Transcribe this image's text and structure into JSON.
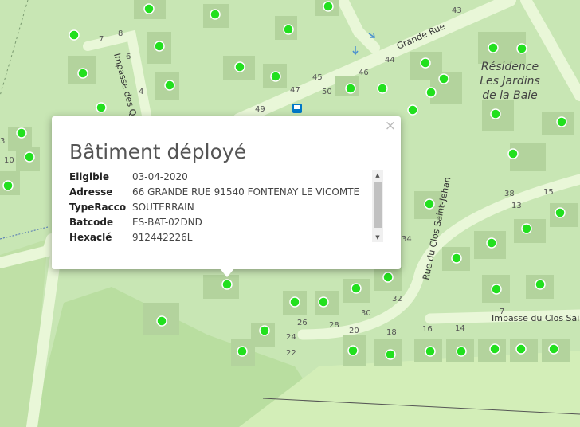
{
  "map": {
    "street_labels": {
      "grande_rue": "Grande Rue",
      "impasse_des": "Impasse des Q",
      "clos_saint_jehan": "Rue du Clos Saint-Jehan",
      "impasse_clos_saint": "Impasse du Clos Sai"
    },
    "residence": {
      "line1": "Résidence",
      "line2": "Les Jardins",
      "line3": "de la Baie"
    },
    "house_numbers": [
      "7",
      "8",
      "6",
      "4",
      "49",
      "47",
      "45",
      "46",
      "50",
      "44",
      "43",
      "3",
      "10",
      "38",
      "15",
      "13",
      "34",
      "32",
      "30",
      "26",
      "28",
      "24",
      "22",
      "20",
      "18",
      "16",
      "14",
      "7"
    ],
    "colors": {
      "background": "#c8e6b4",
      "road": "#e9f7d8",
      "marker": "#22e01e",
      "building": "#b3d39d"
    }
  },
  "popup": {
    "title": "Bâtiment déployé",
    "close_label": "×",
    "fields": [
      {
        "key": "Eligible",
        "value": "03-04-2020"
      },
      {
        "key": "Adresse",
        "value": "66 GRANDE RUE 91540 FONTENAY LE VICOMTE"
      },
      {
        "key": "TypeRacco",
        "value": "SOUTERRAIN"
      },
      {
        "key": "Batcode",
        "value": "ES-BAT-02DND"
      },
      {
        "key": "Hexaclé",
        "value": "912442226L"
      }
    ]
  }
}
